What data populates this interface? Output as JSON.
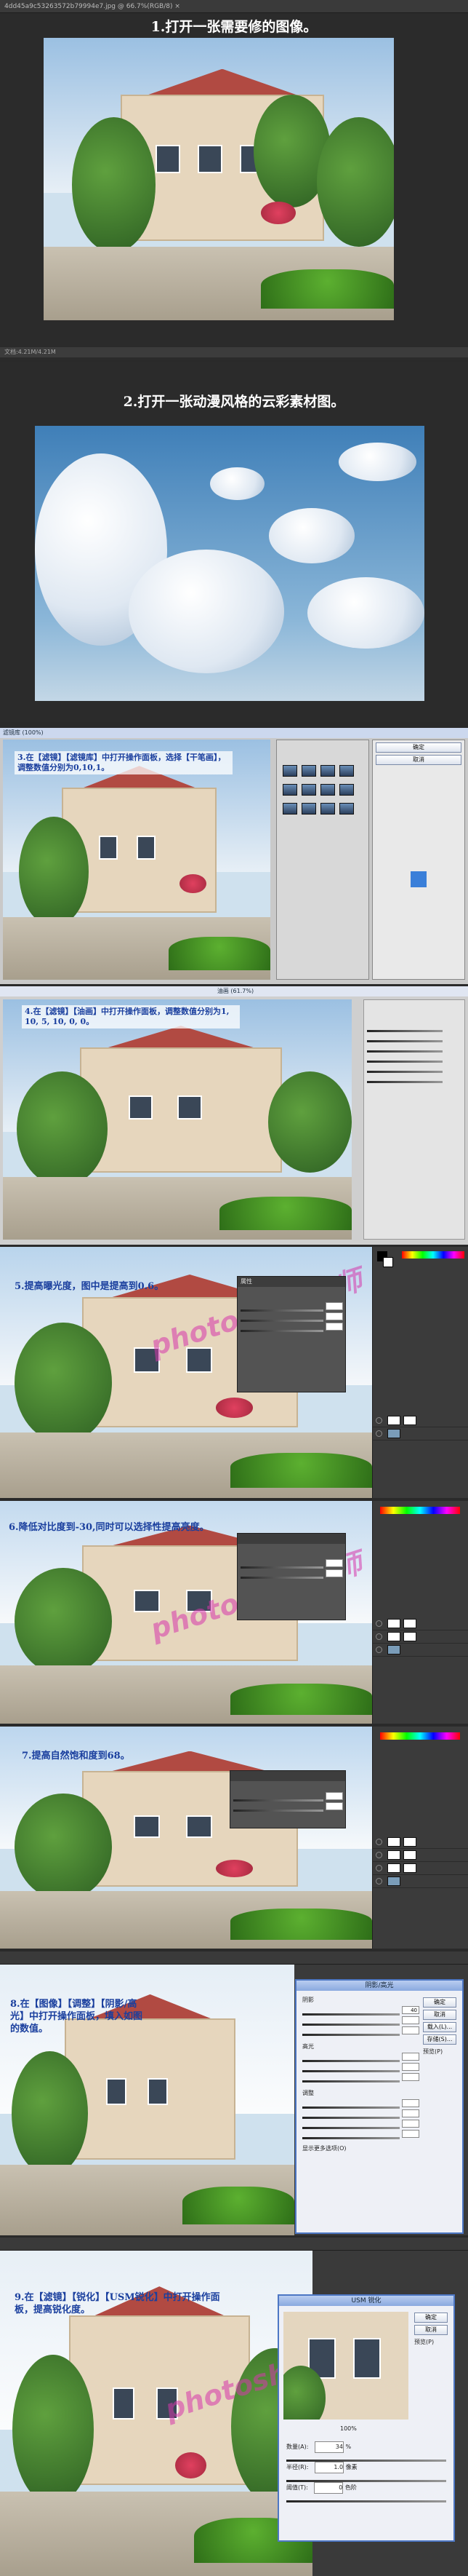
{
  "step1": {
    "tab": "4dd45a9c53263572b79994e7.jpg @ 66.7%(RGB/8) ×",
    "title": "1.打开一张需要修的图像。",
    "status": "文档:4.21M/4.21M"
  },
  "step2": {
    "tab": "",
    "title": "2.打开一张动漫风格的云彩素材图。"
  },
  "step3": {
    "menu_title": "滤镜库 (100%)",
    "caption": "3.在【滤镜】【滤镜库】中打开操作面板，选择【干笔画】，调整数值分别为0,10,1。",
    "ok": "确定",
    "cancel": "取消"
  },
  "step4": {
    "window_title": "油画 (61.7%)",
    "caption": "4.在【滤镜】【油画】中打开操作面板，调整数值分别为1, 10, 5, 10, 0, 0。"
  },
  "step5": {
    "caption": "5.提高曝光度，图中是提高到0.6。",
    "watermark": "photoshop大师",
    "props_title": "属性"
  },
  "step6": {
    "caption": "6.降低对比度到-30,同时可以选择性提高亮度。",
    "watermark": "photoshop大师"
  },
  "step7": {
    "caption": "7.提高自然饱和度到68。"
  },
  "step8": {
    "caption": "8.在【图像】【调整】【阴影/高光】中打开操作面板，填入如图的数值。",
    "dialog_title": "阴影/高光",
    "ok": "确定",
    "cancel": "取消",
    "load": "载入(L)...",
    "save": "存储(S)...",
    "preview": "预览(P)",
    "shadow_label": "阴影",
    "shadow_amount": "40",
    "highlight_label": "高光",
    "adjust_label": "调整",
    "show_more": "显示更多选项(O)"
  },
  "step9": {
    "caption": "9.在【滤镜】【锐化】【USM锐化】中打开操作面板，提高锐化度。",
    "dialog_title": "USM 锐化",
    "ok": "确定",
    "cancel": "取消",
    "preview": "预览(P)",
    "zoom": "100%",
    "amount_label": "数量(A):",
    "amount_value": "34",
    "amount_unit": "%",
    "radius_label": "半径(R):",
    "radius_value": "1.0",
    "radius_unit": "像素",
    "threshold_label": "阈值(T):",
    "threshold_value": "0",
    "threshold_unit": "色阶",
    "watermark": "photoshop大师"
  }
}
